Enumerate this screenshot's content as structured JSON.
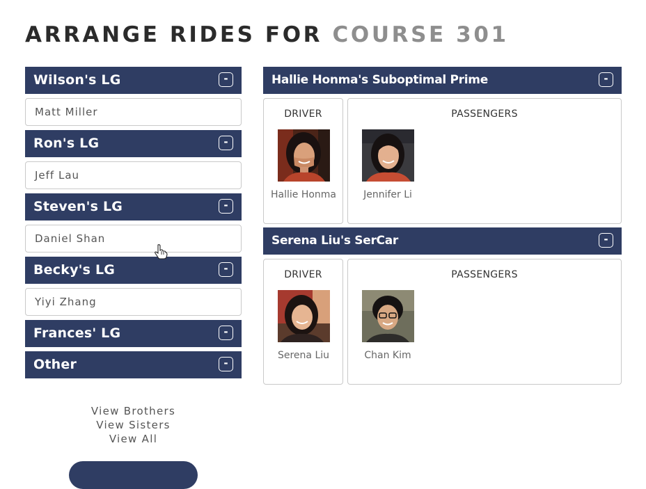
{
  "title": {
    "part1": "ARRANGE RIDES FOR",
    "part2": "COURSE 301"
  },
  "groups": [
    {
      "name": "Wilson's LG",
      "toggle": "-",
      "members": [
        "Matt Miller"
      ]
    },
    {
      "name": "Ron's LG",
      "toggle": "-",
      "members": [
        "Jeff Lau"
      ]
    },
    {
      "name": "Steven's LG",
      "toggle": "-",
      "members": [
        "Daniel Shan"
      ]
    },
    {
      "name": "Becky's LG",
      "toggle": "-",
      "members": [
        "Yiyi Zhang"
      ]
    },
    {
      "name": "Frances' LG",
      "toggle": "-",
      "members": []
    },
    {
      "name": "Other",
      "toggle": "-",
      "members": []
    }
  ],
  "links": [
    "View Brothers",
    "View Sisters",
    "View All"
  ],
  "cars": [
    {
      "name": "Hallie Honma's Suboptimal Prime",
      "toggle": "-",
      "driver_label": "DRIVER",
      "passengers_label": "PASSENGERS",
      "driver": {
        "name": "Hallie Honma",
        "photo": "photo-hallie"
      },
      "passengers": [
        {
          "name": "Jennifer Li",
          "photo": "photo-jennifer"
        }
      ]
    },
    {
      "name": "Serena Liu's SerCar",
      "toggle": "-",
      "driver_label": "DRIVER",
      "passengers_label": "PASSENGERS",
      "driver": {
        "name": "Serena Liu",
        "photo": "photo-serena"
      },
      "passengers": [
        {
          "name": "Chan Kim",
          "photo": "photo-chan"
        }
      ]
    }
  ],
  "colors": {
    "header_bg": "#2f3d63",
    "title_dark": "#2b2b2b",
    "title_gray": "#8e8e8e",
    "border": "#c9c9c9"
  }
}
